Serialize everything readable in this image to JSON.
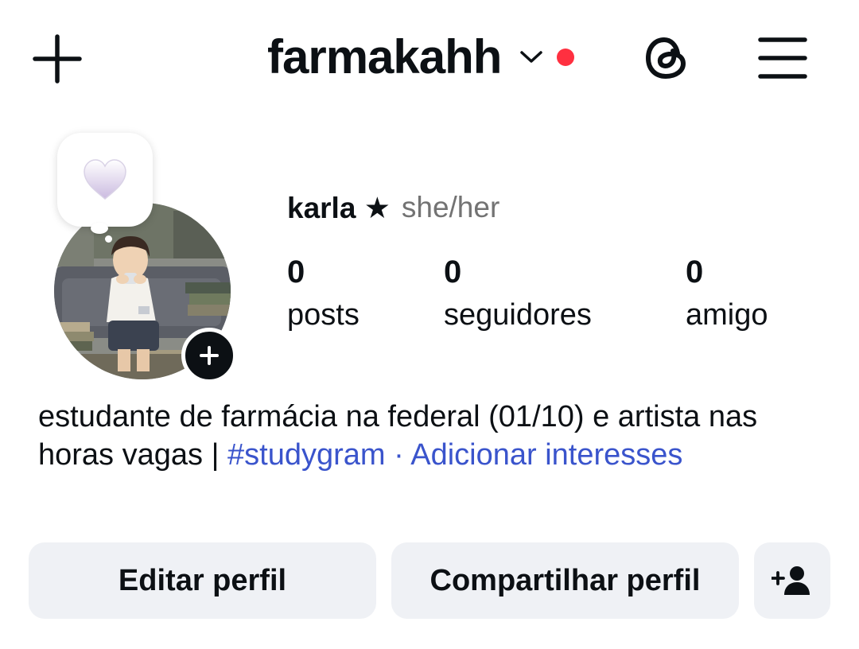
{
  "header": {
    "username": "farmakahh",
    "icons": {
      "create": "plus-icon",
      "account_switch": "chevron-down-icon",
      "notification": "red-dot",
      "threads": "threads-icon",
      "menu": "hamburger-menu-icon"
    },
    "notification_color": "#ff3040"
  },
  "note": {
    "emoji": "🤍"
  },
  "profile": {
    "display_name": "karla ★",
    "pronouns": "she/her",
    "stats": [
      {
        "value": "0",
        "label": "posts"
      },
      {
        "value": "0",
        "label": "seguidores"
      },
      {
        "value": "0",
        "label": "amigo"
      }
    ]
  },
  "bio": {
    "text": "estudante de farmácia na federal (01/10) e artista nas horas vagas | ",
    "hashtag": "#studygram",
    "separator": " · ",
    "add_interests": "Adicionar interesses",
    "link_color": "#3a54cc"
  },
  "actions": {
    "edit": "Editar perfil",
    "share": "Compartilhar perfil",
    "discover_icon": "add-person-icon",
    "button_bg": "#eff1f5"
  }
}
